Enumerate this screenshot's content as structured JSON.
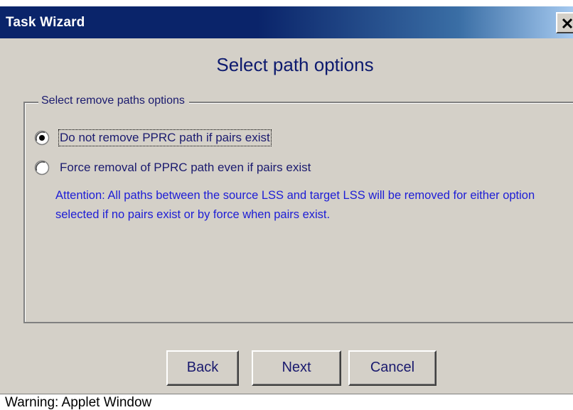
{
  "window": {
    "title": "Task Wizard",
    "close_glyph": "X"
  },
  "page": {
    "heading": "Select path options"
  },
  "group": {
    "legend": "Select remove paths options",
    "options": [
      {
        "label": "Do not remove PPRC path if pairs exist",
        "selected": true
      },
      {
        "label": "Force removal of PPRC path even if pairs exist",
        "selected": false
      }
    ],
    "attention_text": "Attention: All paths between the source LSS and target LSS will be removed for either option selected if no pairs exist or by force when pairs exist."
  },
  "buttons": {
    "back": "Back",
    "next": "Next",
    "cancel": "Cancel"
  },
  "status": {
    "text": "Warning: Applet Window"
  },
  "icons": {
    "close": "close-icon",
    "radio_selected": "radio-selected-icon",
    "radio_unselected": "radio-unselected-icon"
  },
  "colors": {
    "title_bar_start": "#0a246a",
    "title_bar_end": "#a6caf0",
    "window_bg": "#d4d0c8",
    "heading_text": "#0d1a6e",
    "attention_text": "#1d1dd6"
  }
}
